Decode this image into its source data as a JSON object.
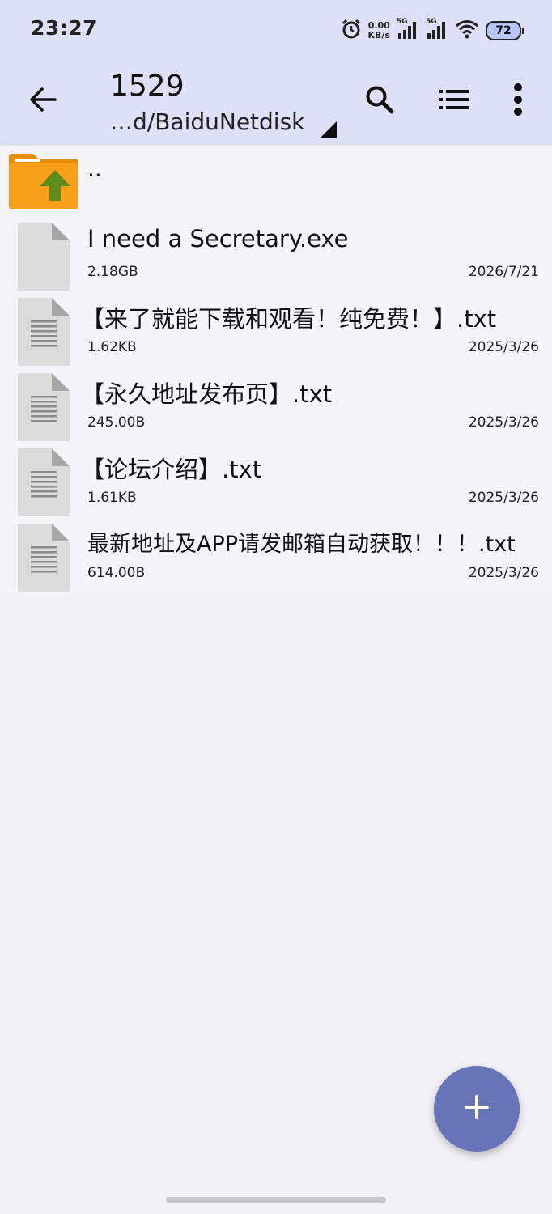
{
  "status_bar": {
    "time": "23:27",
    "net_speed_value": "0.00",
    "net_speed_unit": "KB/s",
    "sim1_network": "5G",
    "sim2_network": "5G",
    "battery": "72",
    "icons": [
      "alarm-icon",
      "signal-icon",
      "wifi-icon",
      "battery-icon"
    ]
  },
  "toolbar": {
    "title": "1529",
    "path": "…d/BaiduNetdisk",
    "icons": [
      "back-arrow-icon",
      "search-icon",
      "list-view-icon",
      "more-vert-icon"
    ]
  },
  "parent_entry": {
    "label": ".."
  },
  "files": [
    {
      "name": "I need a Secretary.exe",
      "size": "2.18GB",
      "date": "2026/7/21",
      "icon": "blank-file-icon"
    },
    {
      "name": "【来了就能下载和观看！纯免费！】.txt",
      "size": "1.62KB",
      "date": "2025/3/26",
      "icon": "text-file-icon"
    },
    {
      "name": "【永久地址发布页】.txt",
      "size": "245.00B",
      "date": "2025/3/26",
      "icon": "text-file-icon"
    },
    {
      "name": "【论坛介绍】.txt",
      "size": "1.61KB",
      "date": "2025/3/26",
      "icon": "text-file-icon"
    },
    {
      "name": "最新地址及APP请发邮箱自动获取！！！.txt",
      "size": "614.00B",
      "date": "2025/3/26",
      "icon": "text-file-icon"
    }
  ],
  "colors": {
    "app_bar": "#dde0f6",
    "background": "#f2f1f6",
    "fab": "#6775b8",
    "folder": "#f9a01b",
    "folder_arrow": "#5e8c1e"
  }
}
